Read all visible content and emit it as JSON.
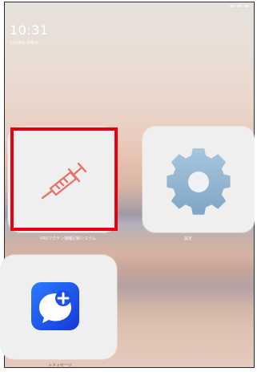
{
  "status_bar": {
    "time": "10:31",
    "date": "5月28日 日曜日"
  },
  "apps": [
    {
      "label": "VRSワクチン接種記録システム",
      "icon": "syringe-icon",
      "color": "#e8736b",
      "highlighted": true
    },
    {
      "label": "設定",
      "icon": "gear-icon",
      "color": "#8fb5d3",
      "highlighted": false
    },
    {
      "label": "＋メッセージ",
      "icon": "message-plus-icon",
      "color": "#1a5cf0",
      "highlighted": false
    }
  ],
  "highlight": {
    "color": "#e60012"
  }
}
